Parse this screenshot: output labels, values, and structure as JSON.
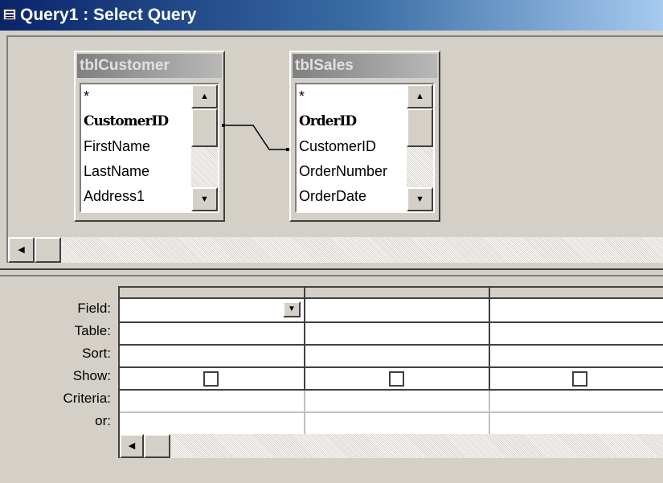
{
  "window": {
    "title": "Query1 : Select Query"
  },
  "tables": [
    {
      "name": "tblCustomer",
      "fields": [
        "*",
        "CustomerID",
        "FirstName",
        "LastName",
        "Address1"
      ],
      "primary_key": "CustomerID"
    },
    {
      "name": "tblSales",
      "fields": [
        "*",
        "OrderID",
        "CustomerID",
        "OrderNumber",
        "OrderDate"
      ],
      "primary_key": "OrderID"
    }
  ],
  "relationship": {
    "from": "tblCustomer.CustomerID",
    "to": "tblSales.CustomerID"
  },
  "grid": {
    "row_labels": {
      "field": "Field:",
      "table": "Table:",
      "sort": "Sort:",
      "show": "Show:",
      "criteria": "Criteria:",
      "or": "or:"
    },
    "columns": [
      {
        "field": "",
        "table": "",
        "sort": "",
        "show": false,
        "criteria": "",
        "or": ""
      },
      {
        "field": "",
        "table": "",
        "sort": "",
        "show": false,
        "criteria": "",
        "or": ""
      },
      {
        "field": "",
        "table": "",
        "sort": "",
        "show": false,
        "criteria": "",
        "or": ""
      }
    ]
  },
  "icons": {
    "window_icon": "query-window-icon",
    "scroll_up": "scroll-up-arrow-icon",
    "scroll_down": "scroll-down-arrow-icon",
    "scroll_left": "scroll-left-arrow-icon",
    "dropdown": "dropdown-arrow-icon"
  },
  "colors": {
    "titlebar_start": "#0a246a",
    "titlebar_end": "#a6caf0",
    "face": "#d4d0c8"
  }
}
